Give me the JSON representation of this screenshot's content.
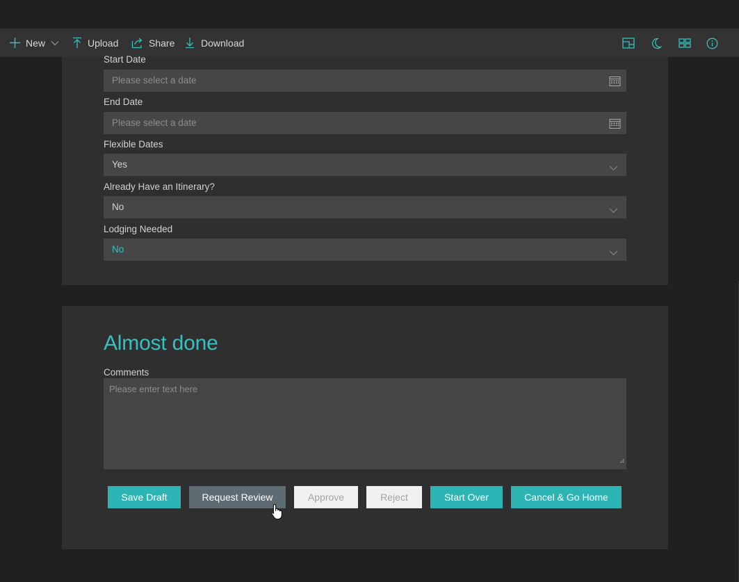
{
  "toolbar": {
    "new_label": "New",
    "upload_label": "Upload",
    "share_label": "Share",
    "download_label": "Download"
  },
  "form": {
    "start_date": {
      "label": "Start Date",
      "placeholder": "Please select a date"
    },
    "end_date": {
      "label": "End Date",
      "placeholder": "Please select a date"
    },
    "flexible_dates": {
      "label": "Flexible Dates",
      "value": "Yes"
    },
    "itinerary": {
      "label": "Already Have an Itinerary?",
      "value": "No"
    },
    "lodging": {
      "label": "Lodging Needed",
      "value": "No"
    }
  },
  "final_section": {
    "heading": "Almost done",
    "comments_label": "Comments",
    "comments_placeholder": "Please enter text here"
  },
  "actions": {
    "save_draft": "Save Draft",
    "request_review": "Request Review",
    "approve": "Approve",
    "reject": "Reject",
    "start_over": "Start Over",
    "cancel_home": "Cancel & Go Home"
  },
  "colors": {
    "accent": "#35c1c1",
    "button_teal": "#2db4b4",
    "background": "#202020",
    "card": "#2f2f2f",
    "field": "#464646"
  },
  "icons": [
    "plus-icon",
    "chevron-down-icon",
    "upload-icon",
    "share-icon",
    "download-icon",
    "layout-icon",
    "moon-icon",
    "dashboard-icon",
    "info-icon",
    "calendar-icon",
    "resize-grip-icon",
    "hand-cursor-icon"
  ]
}
